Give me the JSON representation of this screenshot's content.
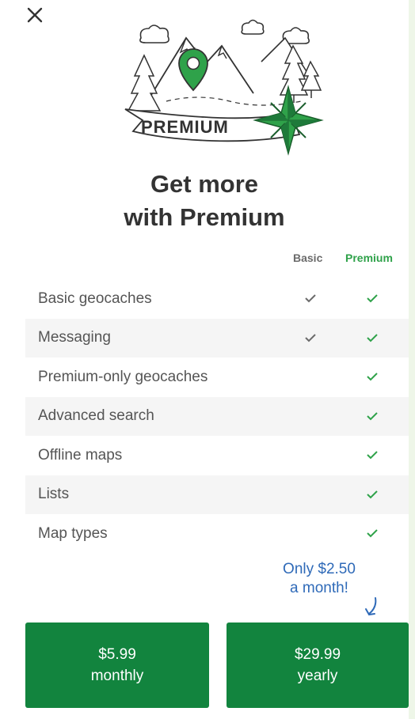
{
  "header": {
    "close_icon": "close-icon",
    "banner_text": "PREMIUM"
  },
  "title": {
    "line1": "Get more",
    "line2": "with Premium"
  },
  "columns": {
    "basic": "Basic",
    "premium": "Premium"
  },
  "features": [
    {
      "label": "Basic geocaches",
      "basic": true,
      "premium": true
    },
    {
      "label": "Messaging",
      "basic": true,
      "premium": true
    },
    {
      "label": "Premium-only geocaches",
      "basic": false,
      "premium": true
    },
    {
      "label": "Advanced search",
      "basic": false,
      "premium": true
    },
    {
      "label": "Offline maps",
      "basic": false,
      "premium": true
    },
    {
      "label": "Lists",
      "basic": false,
      "premium": true
    },
    {
      "label": "Map types",
      "basic": false,
      "premium": true
    }
  ],
  "promo": {
    "line1": "Only $2.50",
    "line2": "a month!"
  },
  "plans": {
    "monthly": {
      "price": "$5.99",
      "period": "monthly"
    },
    "yearly": {
      "price": "$29.99",
      "period": "yearly"
    }
  },
  "colors": {
    "button_green": "#12843e",
    "premium_check": "#2fa24a",
    "basic_check": "#6b6b6b",
    "promo_blue": "#2f6ab8",
    "page_background": "#eef6e8"
  }
}
